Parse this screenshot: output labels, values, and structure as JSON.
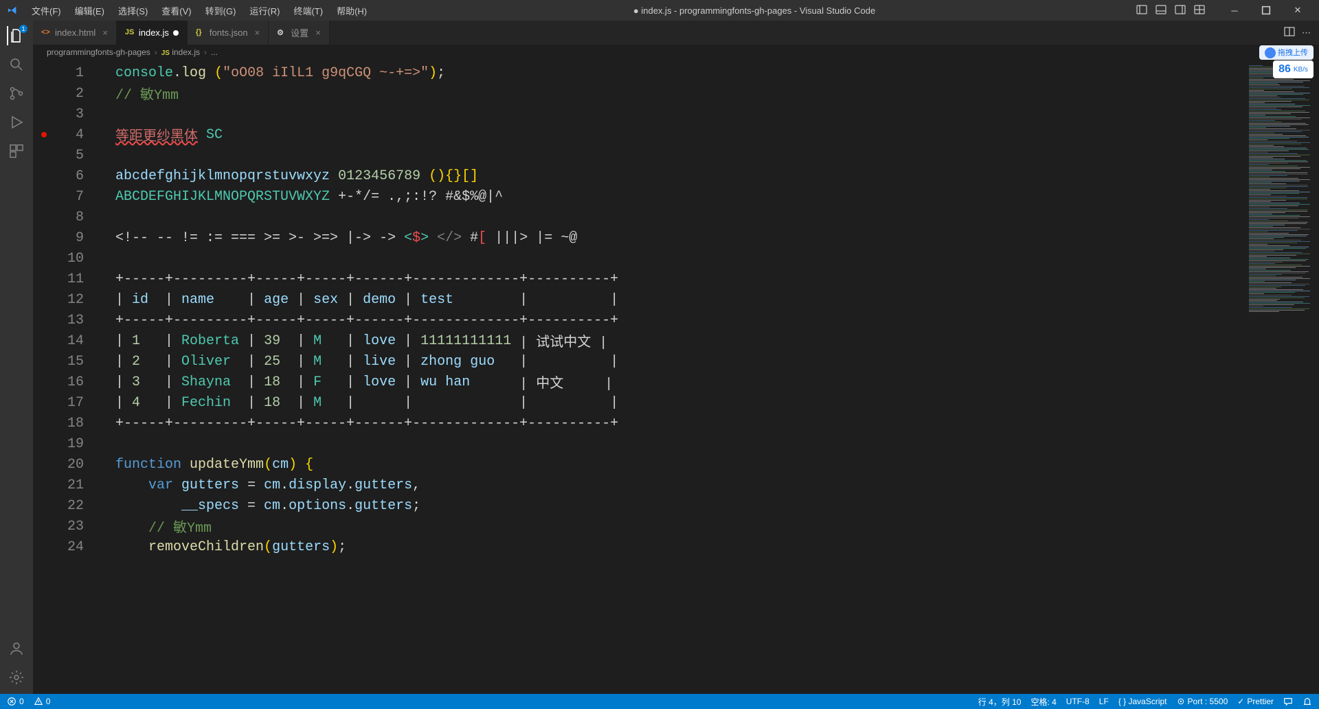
{
  "menu": [
    "文件(F)",
    "编辑(E)",
    "选择(S)",
    "查看(V)",
    "转到(G)",
    "运行(R)",
    "终端(T)",
    "帮助(H)"
  ],
  "title": "● index.js - programmingfonts-gh-pages - Visual Studio Code",
  "tabs": [
    {
      "icon": "html",
      "label": "index.html",
      "active": false,
      "dirty": false
    },
    {
      "icon": "js",
      "label": "index.js",
      "active": true,
      "dirty": true
    },
    {
      "icon": "json",
      "label": "fonts.json",
      "active": false,
      "dirty": false
    },
    {
      "icon": "gear",
      "label": "设置",
      "active": false,
      "dirty": false
    }
  ],
  "breadcrumb": [
    "programmingfonts-gh-pages",
    "index.js",
    "..."
  ],
  "upload": {
    "label": "拖拽上传",
    "speed": "86",
    "unit": "KB/s"
  },
  "code": [
    {
      "n": 1,
      "segs": [
        [
          "tok-obj",
          "console"
        ],
        [
          "tok-default",
          "."
        ],
        [
          "tok-fn",
          "log"
        ],
        [
          "tok-default",
          " "
        ],
        [
          "tok-yellow",
          "("
        ],
        [
          "tok-str",
          "\"oO08 iIlL1 g9qCGQ ~-+=>\""
        ],
        [
          "tok-yellow",
          ")"
        ],
        [
          "tok-default",
          ";"
        ]
      ]
    },
    {
      "n": 2,
      "segs": [
        [
          "tok-comment",
          "// 敏Ymm"
        ]
      ]
    },
    {
      "n": 3,
      "segs": []
    },
    {
      "n": 4,
      "bp": true,
      "segs": [
        [
          "tok-err",
          "等距更纱黑体"
        ],
        [
          "tok-default",
          " "
        ],
        [
          "tok-obj",
          "SC"
        ]
      ]
    },
    {
      "n": 5,
      "segs": []
    },
    {
      "n": 6,
      "segs": [
        [
          "tok-lightblue",
          "abcdefghijklmnopqrstuvwxyz"
        ],
        [
          "tok-default",
          " "
        ],
        [
          "tok-num",
          "0123456789"
        ],
        [
          "tok-default",
          " "
        ],
        [
          "tok-yellow",
          "(){}[]"
        ]
      ]
    },
    {
      "n": 7,
      "segs": [
        [
          "tok-obj",
          "ABCDEFGHIJKLMNOPQRSTUVWXYZ"
        ],
        [
          "tok-default",
          " +-*/= .,;:!? #&$%@|^"
        ]
      ]
    },
    {
      "n": 8,
      "segs": []
    },
    {
      "n": 9,
      "segs": [
        [
          "tok-default",
          "<!-- -- != := === >= >- >=> |-> -> "
        ],
        [
          "tok-teal",
          "<"
        ],
        [
          "tok-red",
          "$"
        ],
        [
          "tok-teal",
          ">"
        ],
        [
          "tok-default",
          " "
        ],
        [
          "tok-tag",
          "</>"
        ],
        [
          "tok-default",
          " #"
        ],
        [
          "tok-red",
          "["
        ],
        [
          "tok-default",
          " |||> |= ~@"
        ]
      ]
    },
    {
      "n": 10,
      "segs": []
    },
    {
      "n": 11,
      "segs": [
        [
          "tok-default",
          "+-----+---------+-----+-----+------+-------------+----------+"
        ]
      ]
    },
    {
      "n": 12,
      "segs": [
        [
          "tok-default",
          "| "
        ],
        [
          "tok-lightblue",
          "id"
        ],
        [
          "tok-default",
          "  | "
        ],
        [
          "tok-lightblue",
          "name"
        ],
        [
          "tok-default",
          "    | "
        ],
        [
          "tok-lightblue",
          "age"
        ],
        [
          "tok-default",
          " | "
        ],
        [
          "tok-lightblue",
          "sex"
        ],
        [
          "tok-default",
          " | "
        ],
        [
          "tok-lightblue",
          "demo"
        ],
        [
          "tok-default",
          " | "
        ],
        [
          "tok-lightblue",
          "test"
        ],
        [
          "tok-default",
          "        |          |"
        ]
      ]
    },
    {
      "n": 13,
      "segs": [
        [
          "tok-default",
          "+-----+---------+-----+-----+------+-------------+----------+"
        ]
      ]
    },
    {
      "n": 14,
      "segs": [
        [
          "tok-default",
          "| "
        ],
        [
          "tok-num",
          "1"
        ],
        [
          "tok-default",
          "   | "
        ],
        [
          "tok-obj",
          "Roberta"
        ],
        [
          "tok-default",
          " | "
        ],
        [
          "tok-num",
          "39"
        ],
        [
          "tok-default",
          "  | "
        ],
        [
          "tok-obj",
          "M"
        ],
        [
          "tok-default",
          "   | "
        ],
        [
          "tok-lightblue",
          "love"
        ],
        [
          "tok-default",
          " | "
        ],
        [
          "tok-num",
          "11111111111"
        ],
        [
          "tok-default",
          " | 试试中文 |"
        ]
      ]
    },
    {
      "n": 15,
      "segs": [
        [
          "tok-default",
          "| "
        ],
        [
          "tok-num",
          "2"
        ],
        [
          "tok-default",
          "   | "
        ],
        [
          "tok-obj",
          "Oliver"
        ],
        [
          "tok-default",
          "  | "
        ],
        [
          "tok-num",
          "25"
        ],
        [
          "tok-default",
          "  | "
        ],
        [
          "tok-obj",
          "M"
        ],
        [
          "tok-default",
          "   | "
        ],
        [
          "tok-lightblue",
          "live"
        ],
        [
          "tok-default",
          " | "
        ],
        [
          "tok-lightblue",
          "zhong"
        ],
        [
          "tok-default",
          " "
        ],
        [
          "tok-lightblue",
          "guo"
        ],
        [
          "tok-default",
          "   |          |"
        ]
      ]
    },
    {
      "n": 16,
      "segs": [
        [
          "tok-default",
          "| "
        ],
        [
          "tok-num",
          "3"
        ],
        [
          "tok-default",
          "   | "
        ],
        [
          "tok-obj",
          "Shayna"
        ],
        [
          "tok-default",
          "  | "
        ],
        [
          "tok-num",
          "18"
        ],
        [
          "tok-default",
          "  | "
        ],
        [
          "tok-obj",
          "F"
        ],
        [
          "tok-default",
          "   | "
        ],
        [
          "tok-lightblue",
          "love"
        ],
        [
          "tok-default",
          " | "
        ],
        [
          "tok-lightblue",
          "wu"
        ],
        [
          "tok-default",
          " "
        ],
        [
          "tok-lightblue",
          "han"
        ],
        [
          "tok-default",
          "      | 中文     |"
        ]
      ]
    },
    {
      "n": 17,
      "segs": [
        [
          "tok-default",
          "| "
        ],
        [
          "tok-num",
          "4"
        ],
        [
          "tok-default",
          "   | "
        ],
        [
          "tok-obj",
          "Fechin"
        ],
        [
          "tok-default",
          "  | "
        ],
        [
          "tok-num",
          "18"
        ],
        [
          "tok-default",
          "  | "
        ],
        [
          "tok-obj",
          "M"
        ],
        [
          "tok-default",
          "   |      |             |          |"
        ]
      ]
    },
    {
      "n": 18,
      "segs": [
        [
          "tok-default",
          "+-----+---------+-----+-----+------+-------------+----------+"
        ]
      ]
    },
    {
      "n": 19,
      "segs": []
    },
    {
      "n": 20,
      "segs": [
        [
          "tok-key",
          "function"
        ],
        [
          "tok-default",
          " "
        ],
        [
          "tok-fn",
          "updateYmm"
        ],
        [
          "tok-yellow",
          "("
        ],
        [
          "tok-var",
          "cm"
        ],
        [
          "tok-yellow",
          ")"
        ],
        [
          "tok-default",
          " "
        ],
        [
          "tok-yellow",
          "{"
        ]
      ]
    },
    {
      "n": 21,
      "segs": [
        [
          "tok-default",
          "    "
        ],
        [
          "tok-key",
          "var"
        ],
        [
          "tok-default",
          " "
        ],
        [
          "tok-var",
          "gutters"
        ],
        [
          "tok-default",
          " = "
        ],
        [
          "tok-var",
          "cm"
        ],
        [
          "tok-default",
          "."
        ],
        [
          "tok-var",
          "display"
        ],
        [
          "tok-default",
          "."
        ],
        [
          "tok-var",
          "gutters"
        ],
        [
          "tok-default",
          ","
        ]
      ]
    },
    {
      "n": 22,
      "segs": [
        [
          "tok-default",
          "        "
        ],
        [
          "tok-var",
          "__specs"
        ],
        [
          "tok-default",
          " = "
        ],
        [
          "tok-var",
          "cm"
        ],
        [
          "tok-default",
          "."
        ],
        [
          "tok-var",
          "options"
        ],
        [
          "tok-default",
          "."
        ],
        [
          "tok-var",
          "gutters"
        ],
        [
          "tok-default",
          ";"
        ]
      ]
    },
    {
      "n": 23,
      "segs": [
        [
          "tok-default",
          "    "
        ],
        [
          "tok-comment",
          "// 敏Ymm"
        ]
      ]
    },
    {
      "n": 24,
      "segs": [
        [
          "tok-default",
          "    "
        ],
        [
          "tok-fn",
          "removeChildren"
        ],
        [
          "tok-yellow",
          "("
        ],
        [
          "tok-var",
          "gutters"
        ],
        [
          "tok-yellow",
          ")"
        ],
        [
          "tok-default",
          ";"
        ]
      ]
    }
  ],
  "status": {
    "errors": "0",
    "warnings": "0",
    "pos": "行 4，列 10",
    "spaces": "空格: 4",
    "enc": "UTF-8",
    "eol": "LF",
    "lang": "{ } JavaScript",
    "port": "Port : 5500",
    "prettier": "Prettier"
  }
}
